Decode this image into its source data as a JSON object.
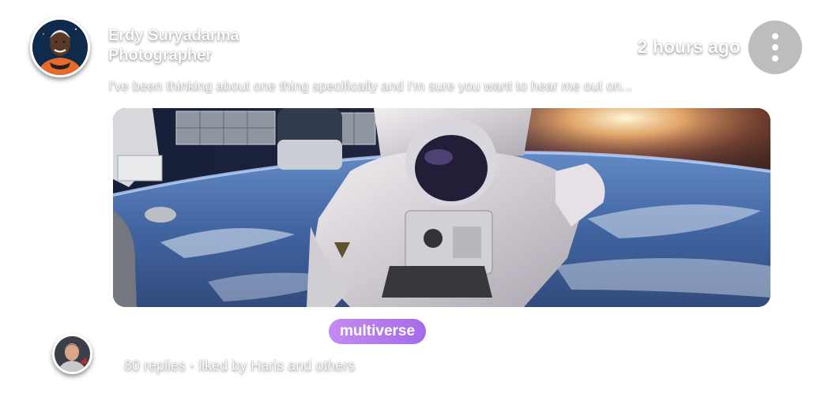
{
  "post": {
    "author": {
      "name": "Erdy Suryadarma",
      "role": "Photographer"
    },
    "timestamp": "2 hours ago",
    "excerpt": "I've been thinking about one thing specifically and I'm sure you want to hear me out on...",
    "media": {
      "subject": "astronaut spacewalk above Earth"
    },
    "tag": "multiverse",
    "footer": {
      "replies": "80 replies",
      "separator": "•",
      "liked_by": "liked by Haris and others"
    },
    "icons": {
      "menu": "more-vertical-icon"
    },
    "colors": {
      "tag_start": "#c48bf0",
      "tag_end": "#a56bea",
      "menu_bg": "#bdbdbd",
      "text": "#ffffff"
    }
  }
}
